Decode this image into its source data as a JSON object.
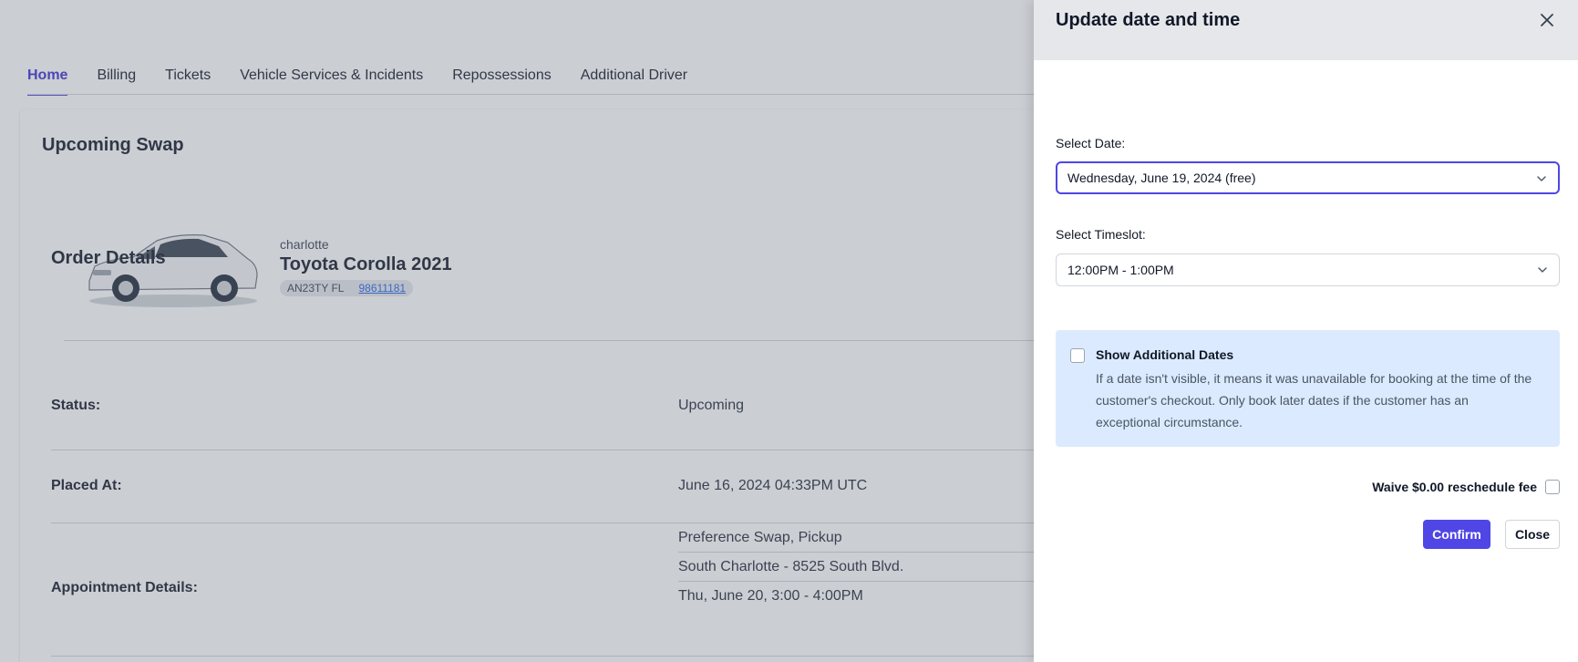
{
  "tabs": [
    {
      "label": "Home",
      "active": true
    },
    {
      "label": "Billing"
    },
    {
      "label": "Tickets"
    },
    {
      "label": "Vehicle Services & Incidents"
    },
    {
      "label": "Repossessions"
    },
    {
      "label": "Additional Driver"
    }
  ],
  "card": {
    "title": "Upcoming Swap",
    "vehicle": {
      "owner": "charlotte",
      "model": "Toyota Corolla 2021",
      "plate": "AN23TY FL",
      "id": "98611181"
    }
  },
  "order": {
    "title": "Order Details",
    "status_label": "Status:",
    "status_value": "Upcoming",
    "placed_label": "Placed At:",
    "placed_value": "June 16, 2024 04:33PM UTC",
    "appointment_label": "Appointment Details:",
    "appointment_lines": [
      "Preference Swap, Pickup",
      "South Charlotte - 8525 South Blvd.",
      "Thu, June 20, 3:00 - 4:00PM"
    ]
  },
  "drawer": {
    "title": "Update date and time",
    "date_label": "Select Date:",
    "date_value": "Wednesday, June 19, 2024 (free)",
    "timeslot_label": "Select Timeslot:",
    "timeslot_value": "12:00PM - 1:00PM",
    "additional_title": "Show Additional Dates",
    "additional_text": "If a date isn't visible, it means it was unavailable for booking at the time of the customer's checkout. Only book later dates if the customer has an exceptional circumstance.",
    "waive_label": "Waive $0.00 reschedule fee",
    "confirm_label": "Confirm",
    "close_label": "Close"
  },
  "colors": {
    "accent": "#4f46e5",
    "info_bg": "#dbeafe",
    "header_bg": "#e5e7eb"
  }
}
